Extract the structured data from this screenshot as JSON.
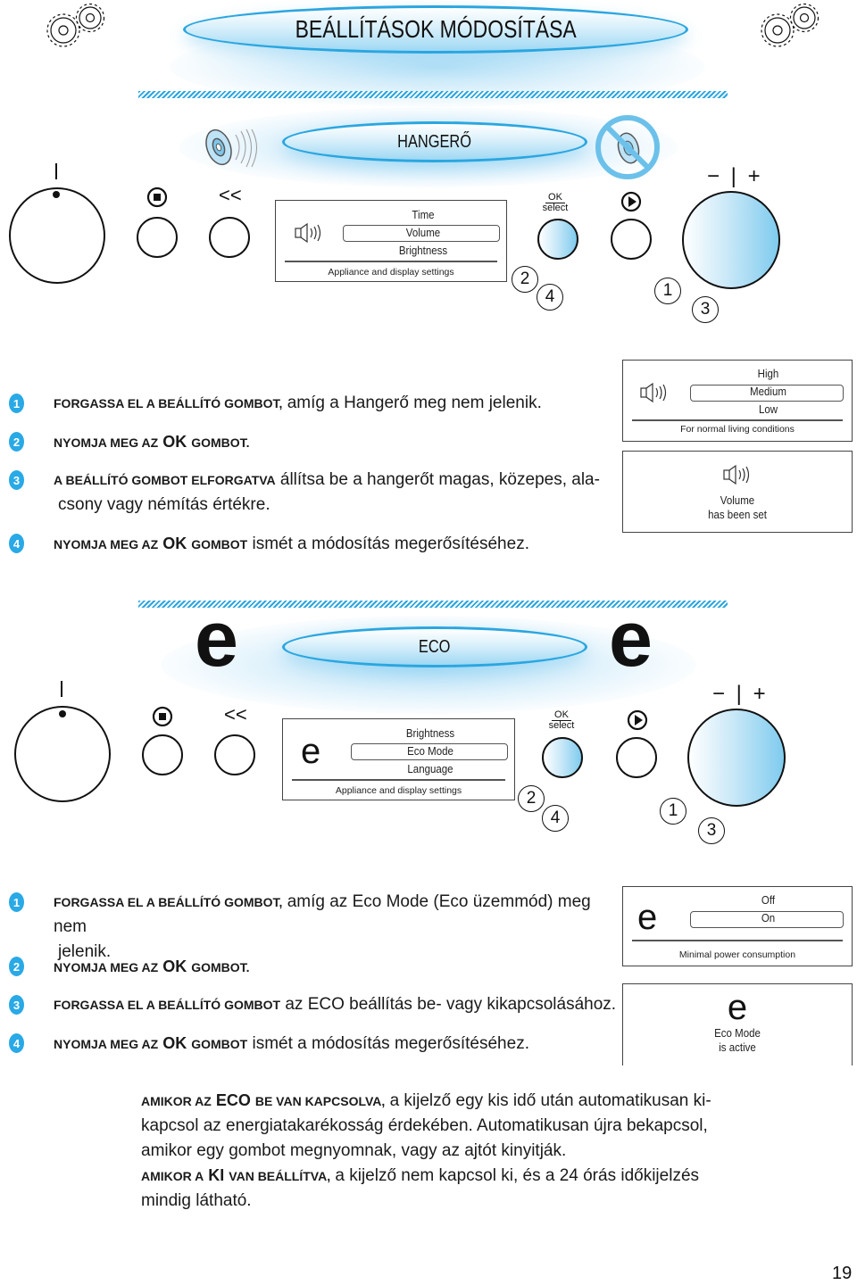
{
  "header": {
    "title": "BEÁLLÍTÁSOK MÓDOSÍTÁSA",
    "icons": [
      "gears-icon",
      "gears-icon"
    ]
  },
  "volume_section": {
    "title": "HANGERŐ",
    "icons": [
      "speaker-icon",
      "mute-speaker-icon"
    ],
    "panel": {
      "knob_left_mark": "|",
      "stop_symbol": "stop-icon",
      "back_symbol": "<<",
      "ok_label_top": "OK",
      "ok_label_bottom": "select",
      "play_symbol": "play-icon",
      "right_knob_marks": "− | +",
      "callouts": [
        "2",
        "4",
        "1",
        "3"
      ],
      "display": {
        "icon": "speaker-icon",
        "items": [
          "Time",
          "Volume",
          "Brightness"
        ],
        "selected": "Volume",
        "footer": "Appliance and display settings"
      }
    },
    "steps": [
      {
        "num": "1",
        "caps": "Forgassa el a beállító gombot,",
        "text": " amíg a Hangerő meg nem jelenik."
      },
      {
        "num": "2",
        "caps": "Nyomja meg az",
        "bold": " OK ",
        "caps2": "gombot.",
        "text": ""
      },
      {
        "num": "3",
        "caps": "A beállító gombot elforgatva",
        "text": " állítsa be a hangerőt magas, közepes, ala-",
        "text2": "csony vagy némítás értékre."
      },
      {
        "num": "4",
        "caps": "Nyomja meg az",
        "bold": " OK ",
        "caps2": "gombot",
        "text": " ismét a módosítás megerősítéséhez."
      }
    ],
    "display_options": {
      "icon": "speaker-icon",
      "items": [
        "High",
        "Medium",
        "Low"
      ],
      "selected": "Medium",
      "footer": "For normal living conditions"
    },
    "display_confirm": {
      "icon": "speaker-icon",
      "line1": "Volume",
      "line2": "has been set"
    }
  },
  "eco_section": {
    "title": "ECO",
    "icons": [
      "eco-e-icon",
      "eco-e-icon"
    ],
    "panel": {
      "knob_left_mark": "|",
      "stop_symbol": "stop-icon",
      "back_symbol": "<<",
      "ok_label_top": "OK",
      "ok_label_bottom": "select",
      "play_symbol": "play-icon",
      "right_knob_marks": "− | +",
      "callouts": [
        "2",
        "4",
        "1",
        "3"
      ],
      "display": {
        "icon": "eco-e-icon",
        "icon_char": "e",
        "items": [
          "Brightness",
          "Eco Mode",
          "Language"
        ],
        "selected": "Eco Mode",
        "footer": "Appliance and display settings"
      }
    },
    "steps": [
      {
        "num": "1",
        "caps": "Forgassa el a beállító gombot,",
        "text": " amíg az Eco Mode (Eco üzemmód) meg nem",
        "text2": "jelenik."
      },
      {
        "num": "2",
        "caps": "Nyomja meg az",
        "bold": " OK ",
        "caps2": "gombot.",
        "text": ""
      },
      {
        "num": "3",
        "caps": "Forgassa el a beállító gombot",
        "text": " az ECO beállítás be- vagy kikapcsolásához."
      },
      {
        "num": "4",
        "caps": "Nyomja meg az",
        "bold": " OK ",
        "caps2": "gombot",
        "text": " ismét a módosítás megerősítéséhez."
      }
    ],
    "display_options": {
      "icon_char": "e",
      "items": [
        "Off",
        "On"
      ],
      "selected": "On",
      "footer": "Minimal power consumption"
    },
    "display_confirm": {
      "icon_char": "e",
      "line1": "Eco Mode",
      "line2": "is active"
    }
  },
  "notes": {
    "p1_caps": "Amikor az",
    "p1_bold": " ECO ",
    "p1_caps2": "be van kapcsolva,",
    "p1_text": " a kijelző egy kis idő után automatikusan ki-kapcsol az energiatakarékosság érdekében. Automatikusan újra bekapcsol, amikor egy gombot megnyomnak, vagy az ajtót kinyitják.",
    "p2_caps": "Amikor a",
    "p2_bold": " KI ",
    "p2_caps2": "van beállítva,",
    "p2_text": " a kijelző nem kapcsol ki, és a 24 órás időkijelzés mindig látható."
  },
  "page_number": "19",
  "colors": {
    "accent": "#29a9e6",
    "accent_light": "#cbe9f8",
    "text": "#111111"
  }
}
